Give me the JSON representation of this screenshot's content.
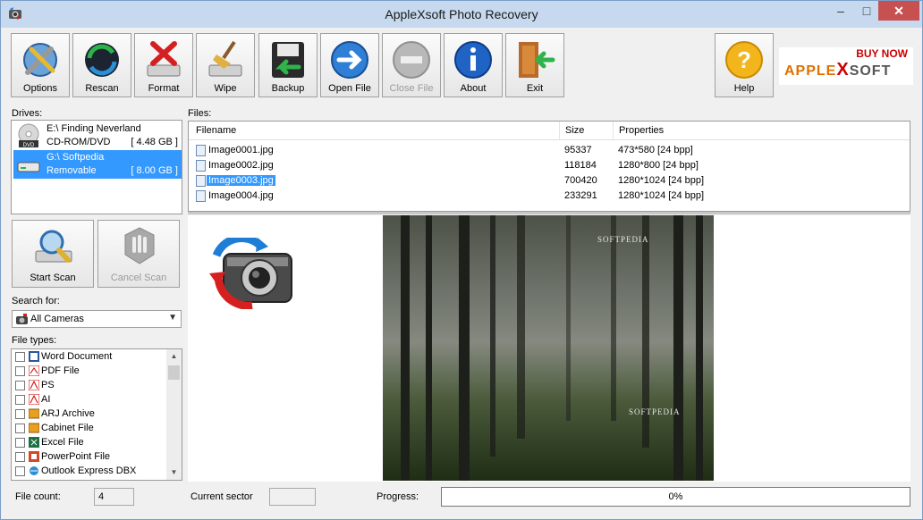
{
  "window": {
    "title": "AppleXsoft Photo Recovery"
  },
  "toolbar": {
    "options": "Options",
    "rescan": "Rescan",
    "format": "Format",
    "wipe": "Wipe",
    "backup": "Backup",
    "open_file": "Open File",
    "close_file": "Close File",
    "about": "About",
    "exit": "Exit",
    "help": "Help"
  },
  "banner": {
    "buy_now": "BUY NOW",
    "logo_a": "APPLE",
    "logo_x": "X",
    "logo_b": "SOFT"
  },
  "drives": {
    "label": "Drives:",
    "items": [
      {
        "name": "E:\\ Finding Neverland",
        "type": "CD-ROM/DVD",
        "size": "[ 4.48 GB ]",
        "selected": false
      },
      {
        "name": "G:\\ Softpedia",
        "type": "Removable",
        "size": "[ 8.00 GB ]",
        "selected": true
      }
    ]
  },
  "files": {
    "label": "Files:",
    "columns": [
      "Filename",
      "Size",
      "Properties"
    ],
    "rows": [
      {
        "filename": "Image0001.jpg",
        "size": "95337",
        "properties": "473*580 [24 bpp]"
      },
      {
        "filename": "Image0002.jpg",
        "size": "118184",
        "properties": "1280*800 [24 bpp]"
      },
      {
        "filename": "Image0003.jpg",
        "size": "700420",
        "properties": "1280*1024 [24 bpp]"
      },
      {
        "filename": "Image0004.jpg",
        "size": "233291",
        "properties": "1280*1024 [24 bpp]"
      }
    ],
    "selected_index": 2
  },
  "scan": {
    "start": "Start Scan",
    "cancel": "Cancel Scan"
  },
  "search": {
    "label": "Search for:",
    "value": "All Cameras"
  },
  "file_types": {
    "label": "File types:",
    "items": [
      "Word Document",
      "PDF File",
      "PS",
      "AI",
      "ARJ Archive",
      "Cabinet File",
      "Excel File",
      "PowerPoint File",
      "Outlook Express DBX"
    ]
  },
  "preview": {
    "watermark": "SOFTPEDIA"
  },
  "status": {
    "file_count_label": "File count:",
    "file_count": "4",
    "sector_label": "Current sector",
    "sector": "",
    "progress_label": "Progress:",
    "progress": "0%",
    "progress_fraction": 0
  }
}
